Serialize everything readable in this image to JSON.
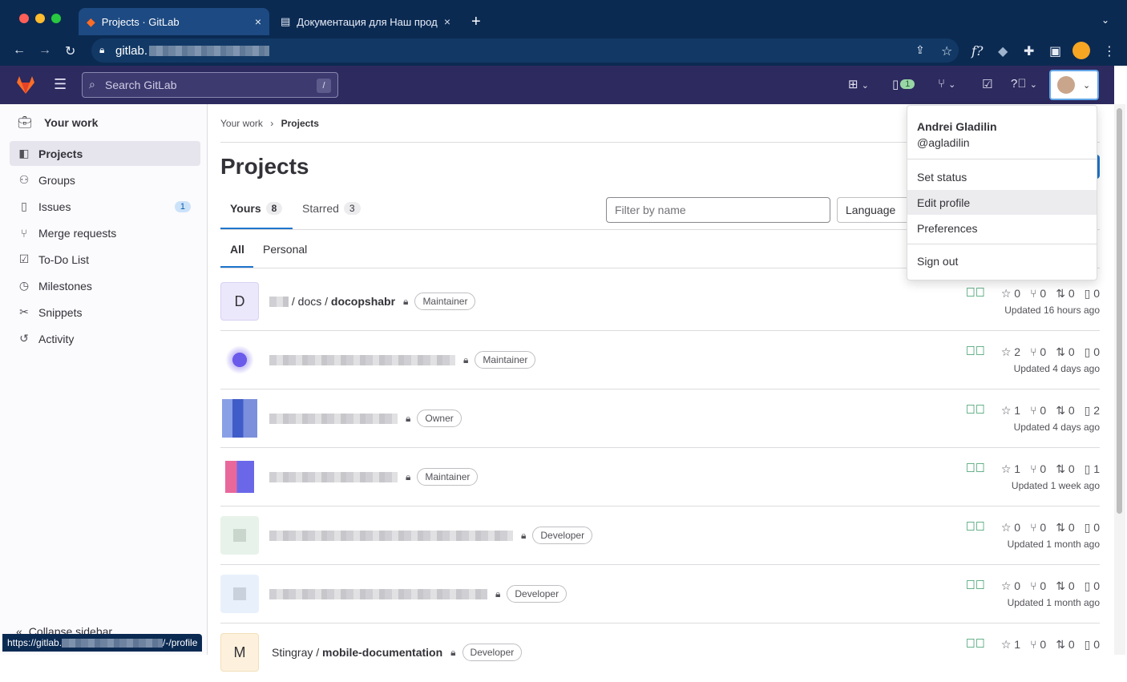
{
  "browser": {
    "tabs": [
      {
        "title": "Projects · GitLab",
        "close": "×"
      },
      {
        "title": "Документация для Наш прод",
        "close": "×"
      }
    ],
    "new_tab": "+",
    "address": "gitlab.",
    "status_url_prefix": "https://gitlab.",
    "status_url_suffix": "/-/profile",
    "profile_icon": "avatar-orange"
  },
  "topbar": {
    "search_placeholder": "Search GitLab",
    "search_shortcut": "/",
    "issues_badge": "1",
    "icons": [
      "plus-icon",
      "issues-icon",
      "merge-request-icon",
      "todo-icon",
      "help-icon",
      "avatar"
    ]
  },
  "sidebar": {
    "heading": "Your work",
    "items": [
      {
        "label": "Projects",
        "icon": "project-icon",
        "selected": true
      },
      {
        "label": "Groups",
        "icon": "group-icon"
      },
      {
        "label": "Issues",
        "icon": "issues-icon",
        "badge": "1"
      },
      {
        "label": "Merge requests",
        "icon": "merge-request-icon"
      },
      {
        "label": "To-Do List",
        "icon": "todo-icon"
      },
      {
        "label": "Milestones",
        "icon": "milestone-icon"
      },
      {
        "label": "Snippets",
        "icon": "snippet-icon"
      },
      {
        "label": "Activity",
        "icon": "history-icon"
      }
    ],
    "collapse": "Collapse sidebar"
  },
  "breadcrumb": {
    "parent": "Your work",
    "current": "Projects"
  },
  "page": {
    "title": "Projects",
    "tabs": [
      {
        "label": "Yours",
        "count": "8"
      },
      {
        "label": "Starred",
        "count": "3"
      }
    ],
    "subtabs": [
      "All",
      "Personal"
    ],
    "filter_placeholder": "Filter by name",
    "language_label": "Language"
  },
  "projects": [
    {
      "avatar": "D",
      "name_mid": " / docs / ",
      "name_bold": "docopshabr",
      "role": "Maintainer",
      "stars": "0",
      "forks": "0",
      "mrs": "0",
      "issues": "0",
      "updated": "Updated 16 hours ago"
    },
    {
      "role": "Maintainer",
      "stars": "2",
      "forks": "0",
      "mrs": "0",
      "issues": "0",
      "updated": "Updated 4 days ago"
    },
    {
      "role": "Owner",
      "stars": "1",
      "forks": "0",
      "mrs": "0",
      "issues": "2",
      "updated": "Updated 4 days ago"
    },
    {
      "role": "Maintainer",
      "stars": "1",
      "forks": "0",
      "mrs": "0",
      "issues": "1",
      "updated": "Updated 1 week ago"
    },
    {
      "role": "Developer",
      "stars": "0",
      "forks": "0",
      "mrs": "0",
      "issues": "0",
      "updated": "Updated 1 month ago"
    },
    {
      "role": "Developer",
      "stars": "0",
      "forks": "0",
      "mrs": "0",
      "issues": "0",
      "updated": "Updated 1 month ago"
    },
    {
      "avatar": "M",
      "name_plain": "Stingray / ",
      "name_bold": "mobile-documentation",
      "role": "Developer",
      "stars": "1",
      "forks": "0",
      "mrs": "0",
      "issues": "0"
    }
  ],
  "user_menu": {
    "name": "Andrei Gladilin",
    "username": "@agladilin",
    "items": [
      "Set status",
      "Edit profile",
      "Preferences",
      "Sign out"
    ],
    "highlighted": "Edit profile"
  },
  "colors": {
    "gitlab_nav": "#2c2a5e",
    "browser_chrome": "#0b2a52",
    "success": "#108548"
  }
}
